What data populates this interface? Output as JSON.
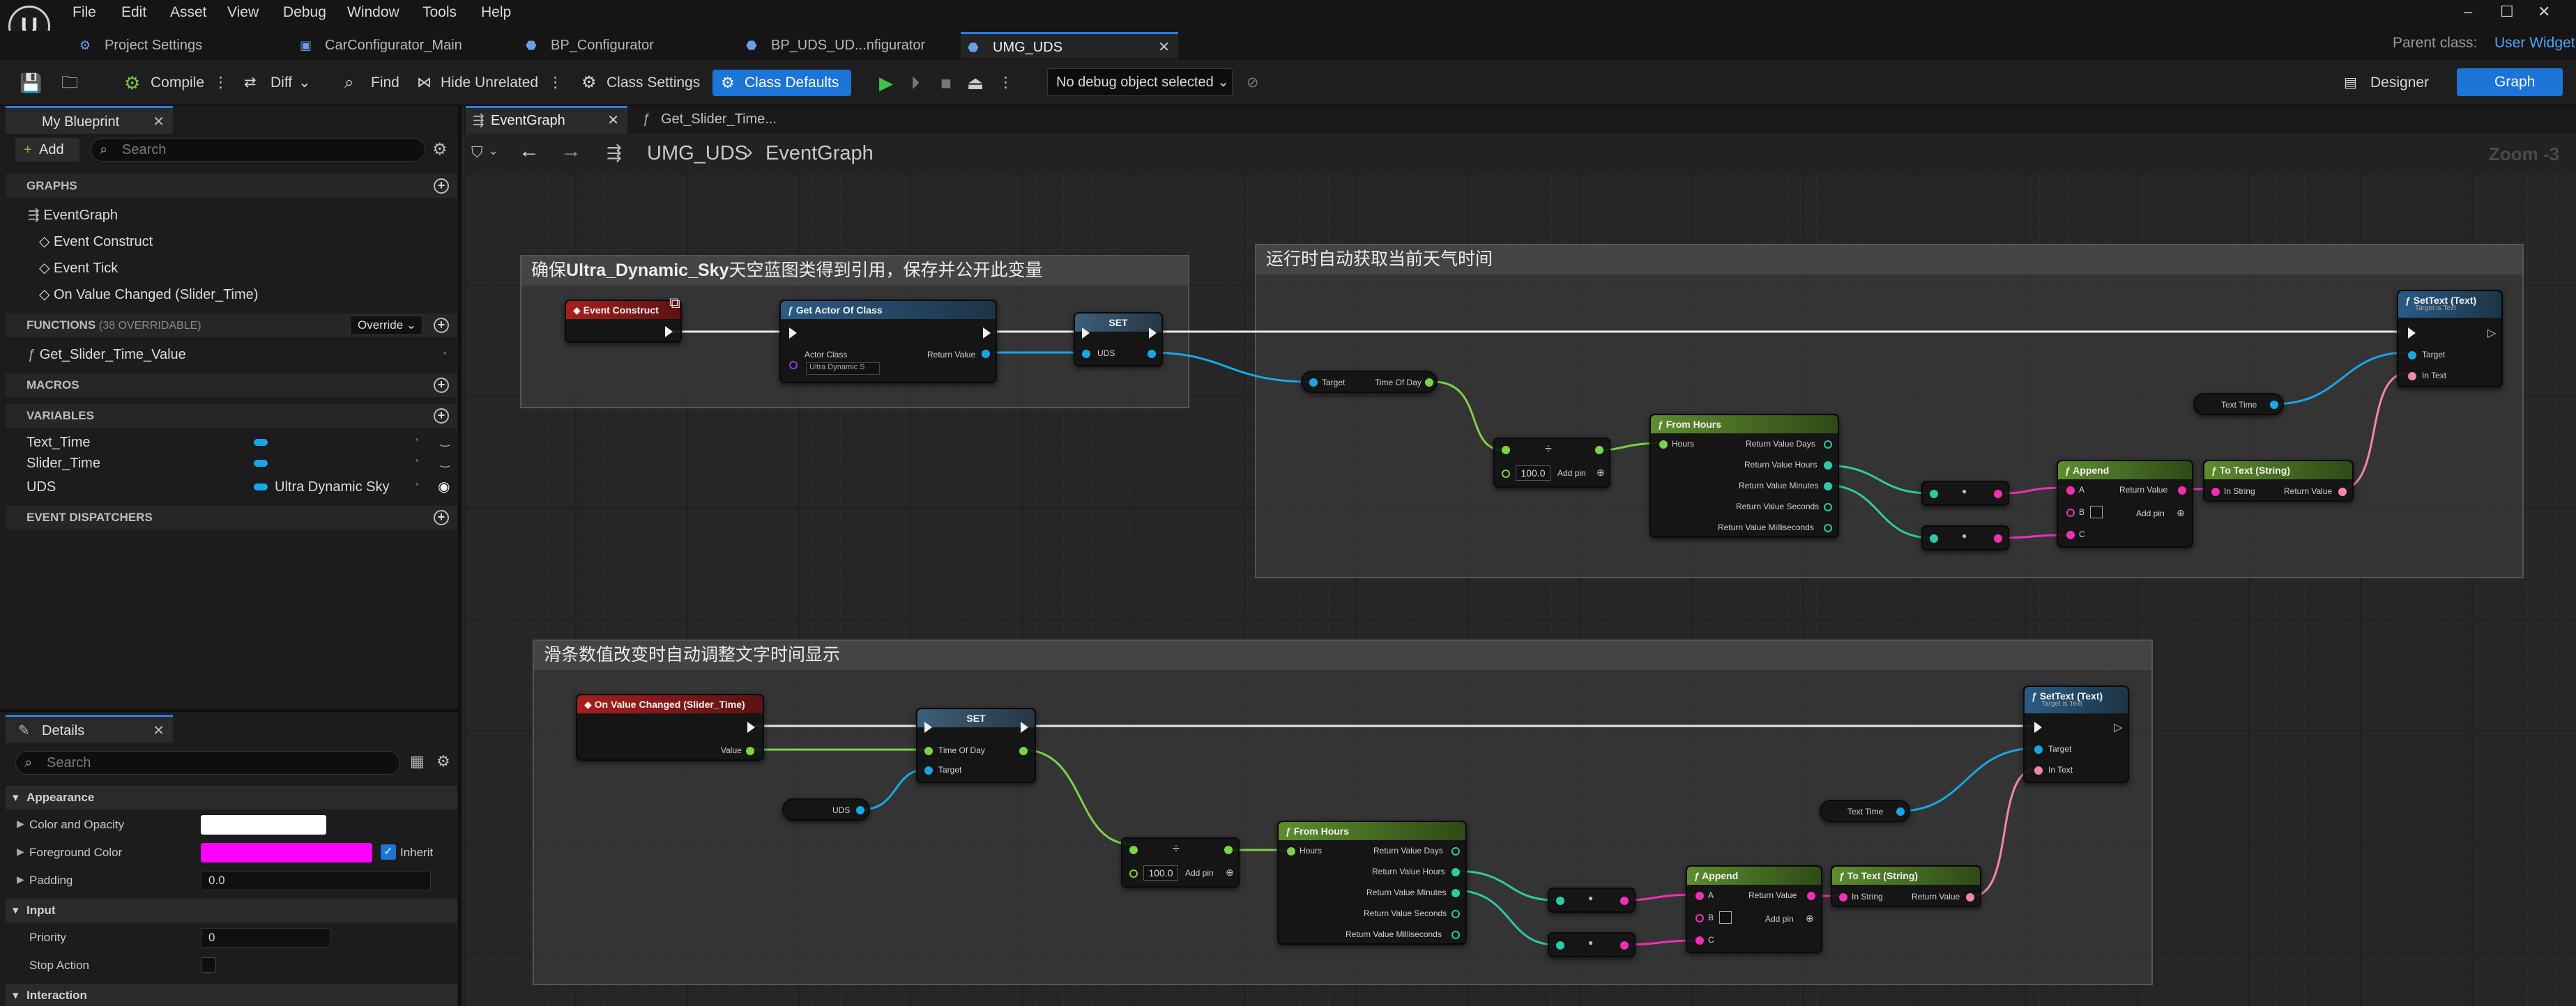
{
  "app": {
    "logo": "U"
  },
  "menu": [
    "File",
    "Edit",
    "Asset",
    "View",
    "Debug",
    "Window",
    "Tools",
    "Help"
  ],
  "tabs": [
    {
      "label": "Project Settings",
      "icon": "settings-icon"
    },
    {
      "label": "CarConfigurator_Main",
      "icon": "level-icon"
    },
    {
      "label": "BP_Configurator",
      "icon": "blueprint-icon"
    },
    {
      "label": "BP_UDS_UD...nfigurator",
      "icon": "blueprint-icon"
    },
    {
      "label": "UMG_UDS",
      "icon": "widget-blueprint-icon",
      "active": true
    }
  ],
  "parent_class": {
    "label": "Parent class:",
    "value": "User Widget"
  },
  "toolbar": {
    "compile": "Compile",
    "diff": "Diff",
    "find": "Find",
    "hide_unrelated": "Hide Unrelated",
    "class_settings": "Class Settings",
    "class_defaults": "Class Defaults",
    "debug_object": "No debug object selected",
    "designer": "Designer",
    "graph": "Graph"
  },
  "my_blueprint": {
    "tab": "My Blueprint",
    "add": "Add",
    "search_placeholder": "Search",
    "graphs_header": "GRAPHS",
    "event_graph": "EventGraph",
    "events": [
      "Event Construct",
      "Event Tick",
      "On Value Changed (Slider_Time)"
    ],
    "functions_header": "FUNCTIONS",
    "functions_sub": "(38 OVERRIDABLE)",
    "override": "Override",
    "functions": [
      "Get_Slider_Time_Value"
    ],
    "macros_header": "MACROS",
    "variables_header": "VARIABLES",
    "variables": [
      {
        "name": "Text_Time",
        "type": ""
      },
      {
        "name": "Slider_Time",
        "type": ""
      },
      {
        "name": "UDS",
        "type": "Ultra Dynamic Sky"
      }
    ],
    "dispatchers_header": "EVENT DISPATCHERS"
  },
  "details": {
    "tab": "Details",
    "search_placeholder": "Search",
    "appearance_header": "Appearance",
    "color_opacity": "Color and Opacity",
    "foreground_color": "Foreground Color",
    "inherit": "Inherit",
    "padding": "Padding",
    "padding_value": "0.0",
    "input_header": "Input",
    "priority": "Priority",
    "priority_value": "0",
    "stop_action": "Stop Action",
    "interaction_header": "Interaction",
    "colors": {
      "color_opacity": "#ffffff",
      "foreground": "#ff00ff"
    }
  },
  "graph": {
    "tabs": [
      "EventGraph",
      "Get_Slider_Time..."
    ],
    "breadcrumb": [
      "UMG_UDS",
      "EventGraph"
    ],
    "zoom": "Zoom -3",
    "comments": [
      {
        "prefix": "确保",
        "bold": "Ultra_Dynamic_Sky",
        "suffix": "天空蓝图类得到引用，保存并公开此变量"
      },
      {
        "title": "运行时自动获取当前天气时间"
      },
      {
        "title": "滑条数值改变时自动调整文字时间显示"
      }
    ],
    "nodes": {
      "event_construct": "Event Construct",
      "get_actor_of_class": "Get Actor Of Class",
      "actor_class": "Actor Class",
      "actor_class_value": "Ultra Dynamic S",
      "return_value": "Return Value",
      "set": "SET",
      "uds": "UDS",
      "target": "Target",
      "time_of_day": "Time Of Day",
      "add_pin": "Add pin",
      "div_value": "100.0",
      "from_hours": "From Hours",
      "hours": "Hours",
      "rv_days": "Return Value Days",
      "rv_hours": "Return Value Hours",
      "rv_minutes": "Return Value Minutes",
      "rv_seconds": "Return Value Seconds",
      "rv_ms": "Return Value Milliseconds",
      "append": "Append",
      "a": "A",
      "b": "B",
      "c": "C",
      "to_text": "To Text (String)",
      "in_string": "In String",
      "set_text": "SetText (Text)",
      "target_is_text": "Target is Text",
      "in_text": "In Text",
      "text_time": "Text Time",
      "on_value_changed": "On Value Changed (Slider_Time)",
      "value": "Value"
    }
  }
}
